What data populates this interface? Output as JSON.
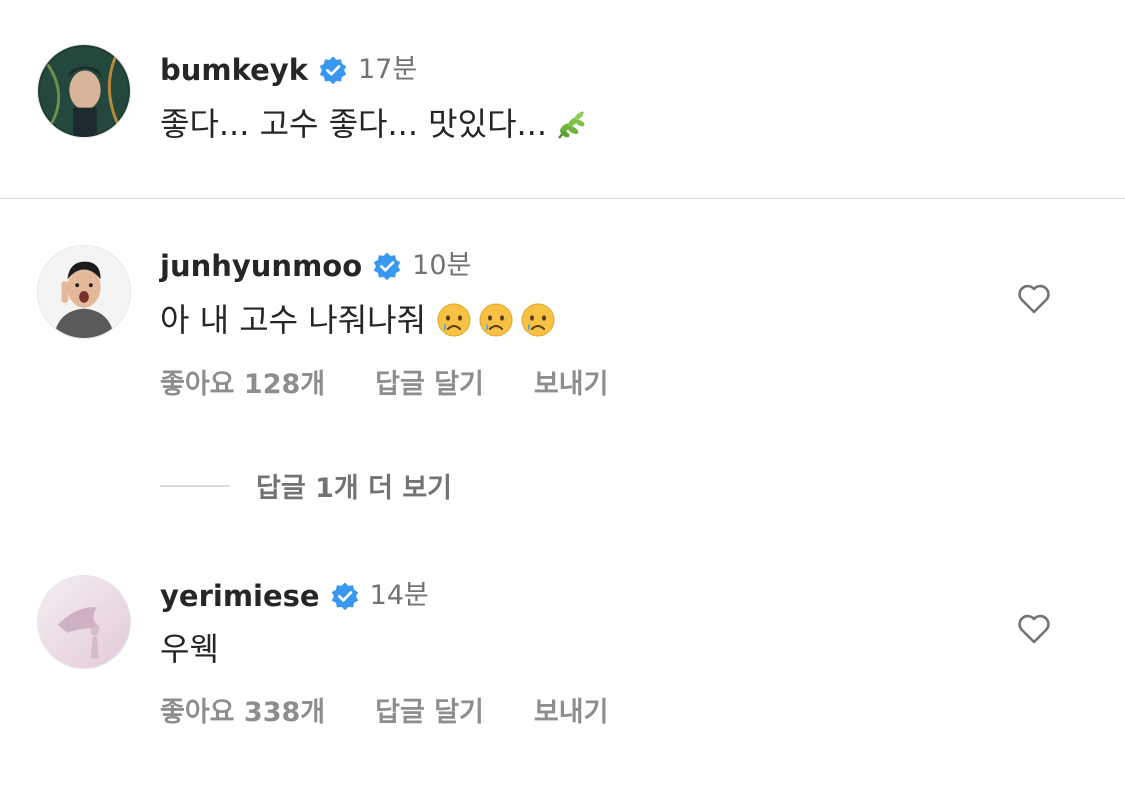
{
  "comments": [
    {
      "username": "bumkeyk",
      "time": "17분",
      "text": "좋다... 고수 좋다... 맛있다...",
      "emoji": "herb-emoji"
    },
    {
      "username": "junhyunmoo",
      "time": "10분",
      "text": "아 내 고수 나줘나줘",
      "emoji": "crying-face-emoji",
      "likes_label": "좋아요 128개",
      "reply_label": "답글 달기",
      "send_label": "보내기"
    },
    {
      "username": "yerimiese",
      "time": "14분",
      "text": "우웩",
      "likes_label": "좋아요 338개",
      "reply_label": "답글 달기",
      "send_label": "보내기"
    }
  ],
  "view_replies_label": "답글 1개 더 보기",
  "icons": {
    "verified": "verified-badge-icon",
    "like": "heart-outline-icon"
  },
  "colors": {
    "verified_blue": "#3897f0",
    "text": "#262626",
    "secondary": "#8e8e8e"
  }
}
